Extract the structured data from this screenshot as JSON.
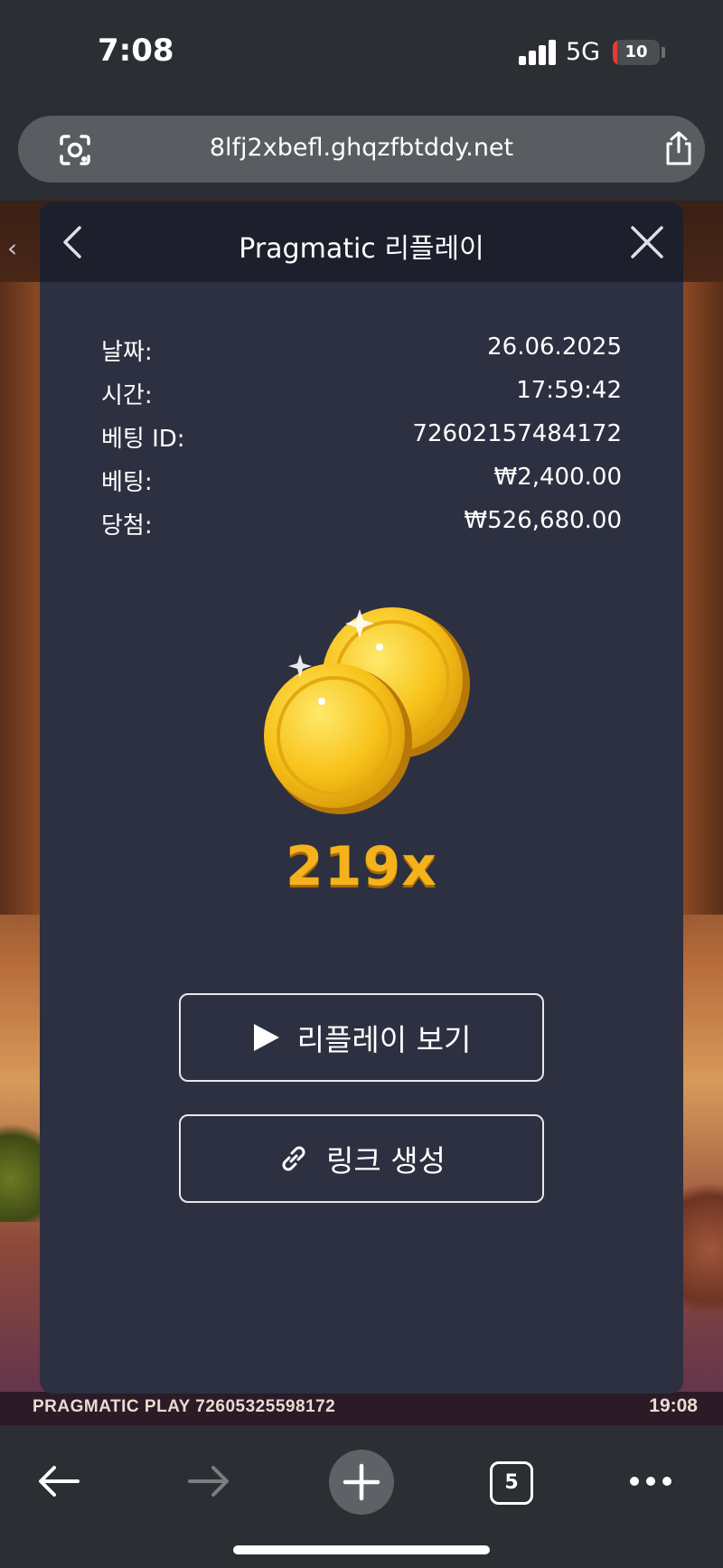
{
  "status_bar": {
    "time": "7:08",
    "network": "5G",
    "battery_level": "10",
    "battery_fraction": 0.1,
    "battery_color": "#e53935"
  },
  "url_bar": {
    "url": "8lfj2xbefl.ghqzfbtddy.net",
    "left_icon": "lens-icon",
    "right_icon": "share-icon"
  },
  "game_background": {
    "footer_left": "PRAGMATIC PLAY  72605325598172",
    "footer_right": "19:08"
  },
  "modal": {
    "title": "Pragmatic 리플레이",
    "back_icon": "chevron-left-icon",
    "close_icon": "close-icon",
    "info": [
      {
        "label": "날짜:",
        "value": "26.06.2025"
      },
      {
        "label": "시간:",
        "value": "17:59:42"
      },
      {
        "label": "베팅 ID:",
        "value": "72602157484172"
      },
      {
        "label": "베팅:",
        "value": "₩2,400.00"
      },
      {
        "label": "당첨:",
        "value": "₩526,680.00"
      }
    ],
    "coin_icon": "gold-coins-icon",
    "multiplier": "219x",
    "multiplier_color": "#f5b21b",
    "replay_button": {
      "label": "리플레이 보기",
      "icon": "play-icon"
    },
    "link_button": {
      "label": "링크 생성",
      "icon": "link-icon"
    }
  },
  "bottom_nav": {
    "tab_count": "5",
    "icons": [
      "arrow-left-icon",
      "arrow-right-icon",
      "plus-icon",
      "tabs-icon",
      "more-icon"
    ]
  }
}
